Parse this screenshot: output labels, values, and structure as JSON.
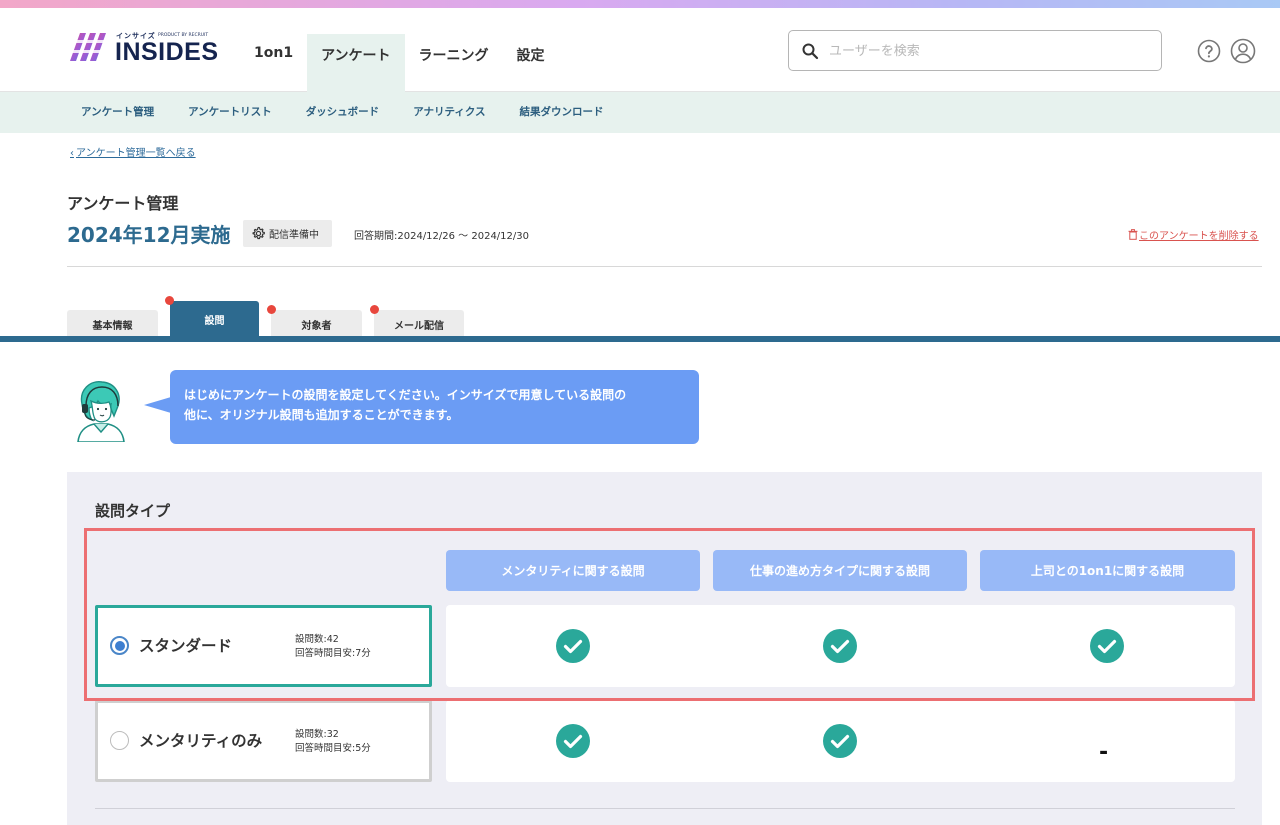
{
  "brand": {
    "kana": "インサイズ",
    "product": "PRODUCT BY RECRUIT",
    "name": "INSIDES"
  },
  "nav": [
    {
      "label": "1on1"
    },
    {
      "label": "アンケート",
      "active": true
    },
    {
      "label": "ラーニング"
    },
    {
      "label": "設定"
    }
  ],
  "search": {
    "placeholder": "ユーザーを検索",
    "value": ""
  },
  "header_icons": {
    "help": "help-icon",
    "user": "user-icon"
  },
  "subnav": [
    "アンケート管理",
    "アンケートリスト",
    "ダッシュボード",
    "アナリティクス",
    "結果ダウンロード"
  ],
  "back_link": "アンケート管理一覧へ戻る",
  "page": {
    "heading": "アンケート管理",
    "title": "2024年12月実施",
    "status": "配信準備中",
    "period": "回答期間:2024/12/26 〜 2024/12/30",
    "delete": "このアンケートを削除する"
  },
  "tabs": [
    {
      "label": "基本情報",
      "active": false,
      "dot": false
    },
    {
      "label": "設問",
      "active": true,
      "dot": true
    },
    {
      "label": "対象者",
      "active": false,
      "dot": true
    },
    {
      "label": "メール配信",
      "active": false,
      "dot": true
    }
  ],
  "assistant": {
    "line1": "はじめにアンケートの設問を設定してください。インサイズで用意している設問の",
    "line2": "他に、オリジナル設問も追加することができます。"
  },
  "question_type": {
    "title": "設問タイプ",
    "columns": [
      "メンタリティに関する設問",
      "仕事の進め方タイプに関する設問",
      "上司との1on1に関する設問"
    ],
    "options": [
      {
        "name": "スタンダード",
        "count": "設問数:42",
        "time": "回答時間目安:7分",
        "selected": true,
        "includes": [
          true,
          true,
          true
        ]
      },
      {
        "name": "メンタリティのみ",
        "count": "設問数:32",
        "time": "回答時間目安:5分",
        "selected": false,
        "includes": [
          true,
          true,
          false
        ],
        "none_mark": "-"
      }
    ]
  },
  "colors": {
    "accent": "#2d6a8f",
    "selected_border": "#2aa89a",
    "check": "#2aa89a",
    "highlight": "#ec6f72",
    "bubble": "#6b9cf4",
    "column_head": "#98b9f7"
  }
}
